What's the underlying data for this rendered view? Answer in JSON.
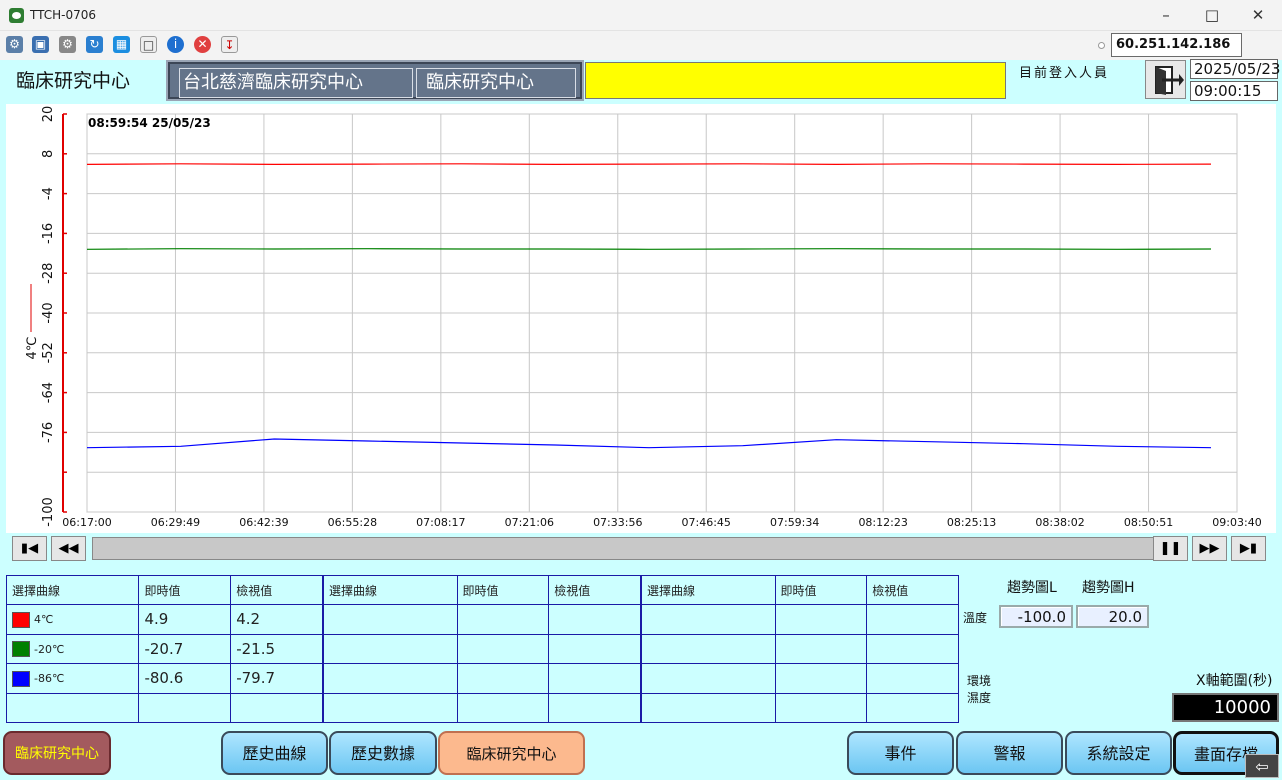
{
  "window": {
    "title": "TTCH-0706"
  },
  "toolbar": {
    "ip": "60.251.142.186"
  },
  "header": {
    "page_title": "臨床研究中心",
    "breadcrumb": [
      "台北慈濟臨床研究中心",
      "臨床研究中心"
    ],
    "login_label": "目前登入人員",
    "date": "2025/05/23",
    "time": "09:00:15"
  },
  "chart_data": {
    "type": "line",
    "cursor_label": "08:59:54  25/05/23",
    "ylabel": "4℃",
    "ylim": [
      -100,
      20
    ],
    "yticks": [
      "20",
      "8",
      "-4",
      "-16",
      "-28",
      "-40",
      "-52",
      "-64",
      "-76",
      "-100"
    ],
    "x": [
      "06:17:00",
      "06:29:49",
      "06:42:39",
      "06:55:28",
      "07:08:17",
      "07:21:06",
      "07:33:56",
      "07:46:45",
      "07:59:34",
      "08:12:23",
      "08:25:13",
      "08:38:02",
      "08:50:51",
      "09:03:40"
    ],
    "grid": true,
    "series": [
      {
        "name": "4℃",
        "color": "#ff0000",
        "values": [
          4.8,
          5.0,
          4.8,
          4.9,
          5.0,
          4.8,
          4.9,
          5.0,
          4.8,
          5.0,
          4.9,
          4.8,
          4.9
        ]
      },
      {
        "name": "-20℃",
        "color": "#008000",
        "values": [
          -20.8,
          -20.6,
          -20.7,
          -20.6,
          -20.7,
          -20.7,
          -20.8,
          -20.7,
          -20.6,
          -20.7,
          -20.7,
          -20.8,
          -20.7
        ]
      },
      {
        "name": "-86℃",
        "color": "#0000ff",
        "values": [
          -80.6,
          -80.2,
          -78.0,
          -78.6,
          -79.2,
          -79.8,
          -80.6,
          -80.0,
          -78.2,
          -78.8,
          -79.4,
          -80.2,
          -80.6
        ]
      }
    ]
  },
  "table": {
    "headers": [
      "選擇曲線",
      "即時值",
      "檢視值"
    ],
    "rows": [
      {
        "name": "4℃",
        "color": "#ff0000",
        "live": "4.9",
        "view": "4.2"
      },
      {
        "name": "-20℃",
        "color": "#008000",
        "live": "-20.7",
        "view": "-21.5"
      },
      {
        "name": "-86℃",
        "color": "#0000ff",
        "live": "-80.6",
        "view": "-79.7"
      }
    ]
  },
  "trend": {
    "label_low": "趨勢圖L",
    "label_high": "趨勢圖H",
    "row1_label": "溫度",
    "temp_low": "-100.0",
    "temp_high": "20.0",
    "row2_label_a": "環境",
    "row2_label_b": "濕度"
  },
  "xrange": {
    "label": "X軸範圍(秒)",
    "value": "10000"
  },
  "bottom_nav": {
    "home": "臨床研究中心",
    "history_curve": "歷史曲線",
    "history_data": "歷史數據",
    "clinical": "臨床研究中心",
    "events": "事件",
    "alarms": "警報",
    "settings": "系統設定",
    "screenshot": "畫面存檔"
  }
}
